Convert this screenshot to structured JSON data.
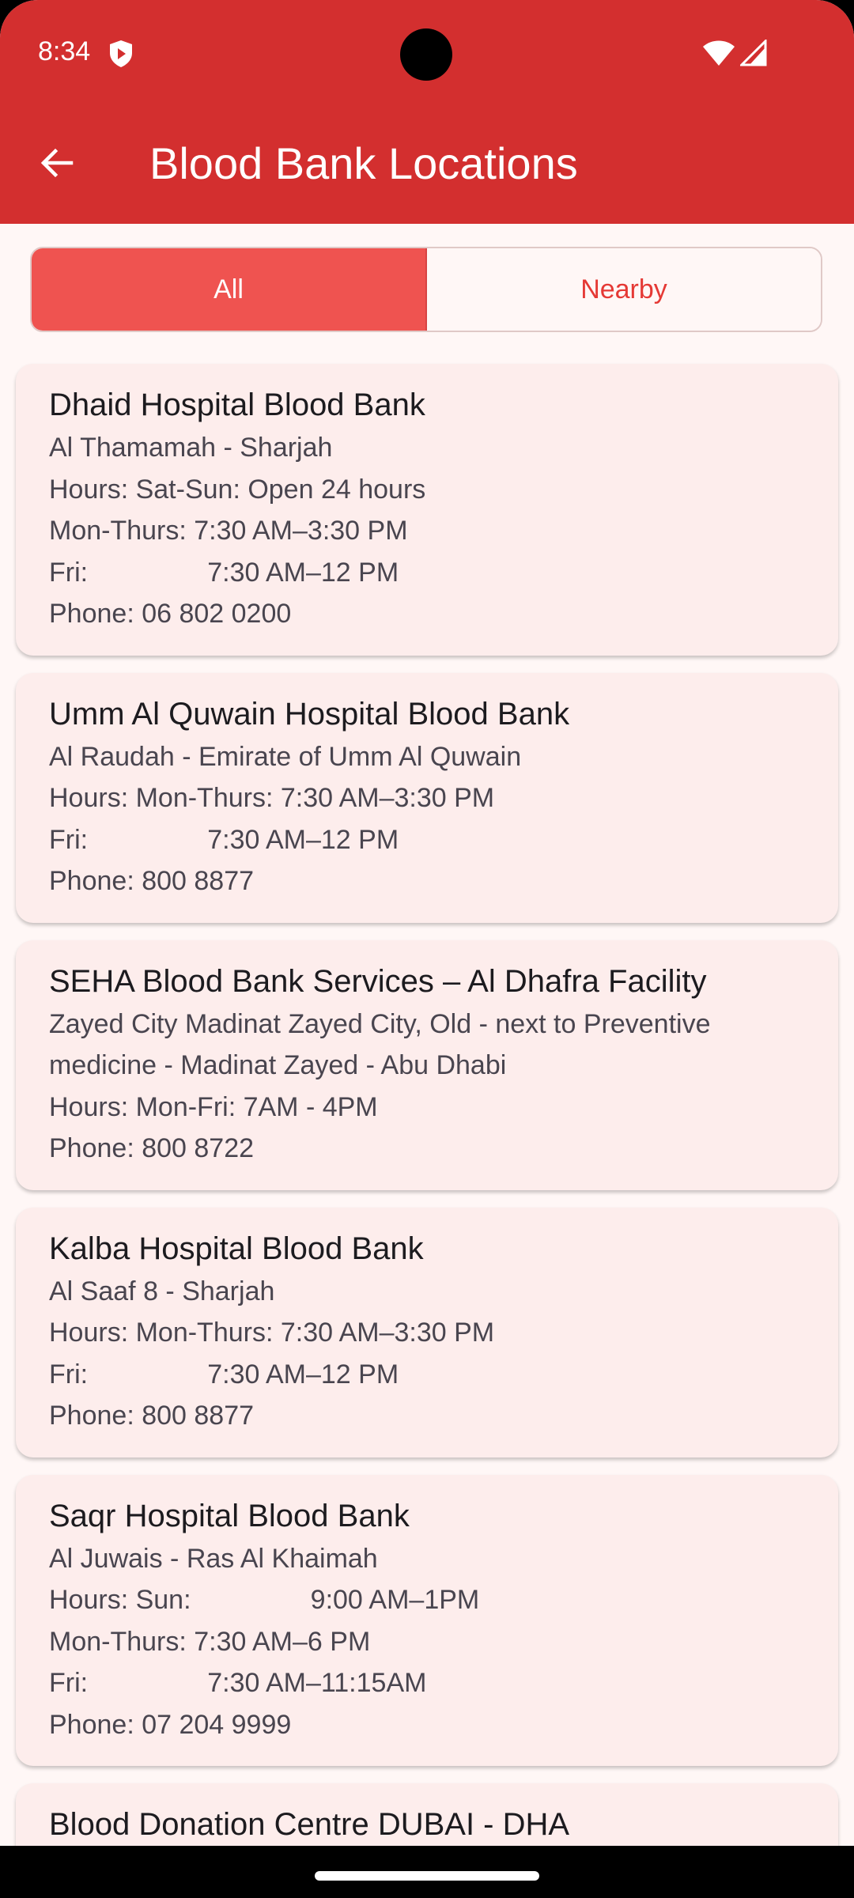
{
  "status_bar": {
    "time": "8:34"
  },
  "app_bar": {
    "title": "Blood Bank Locations"
  },
  "toggle": {
    "all_label": "All",
    "nearby_label": "Nearby"
  },
  "locations": [
    {
      "name": "Dhaid Hospital Blood Bank",
      "lines": [
        "Al Thamamah - Sharjah",
        "Hours: Sat-Sun: Open 24 hours",
        "Mon-Thurs: 7:30 AM–3:30 PM",
        "Fri:                7:30 AM–12 PM",
        "Phone: 06 802 0200"
      ]
    },
    {
      "name": "Umm Al Quwain Hospital Blood Bank",
      "lines": [
        "Al Raudah - Emirate of Umm Al Quwain",
        "Hours: Mon-Thurs: 7:30 AM–3:30 PM",
        "Fri:                7:30 AM–12 PM",
        "Phone: 800 8877"
      ]
    },
    {
      "name": "SEHA Blood Bank Services – Al Dhafra Facility",
      "lines": [
        "Zayed City Madinat Zayed City, Old - next to Preventive medicine - Madinat Zayed - Abu Dhabi",
        "Hours: Mon-Fri: 7AM - 4PM",
        "Phone: 800 8722"
      ]
    },
    {
      "name": "Kalba Hospital Blood Bank",
      "lines": [
        "Al Saaf 8 - Sharjah",
        "Hours: Mon-Thurs: 7:30 AM–3:30 PM",
        "Fri:                7:30 AM–12 PM",
        "Phone: 800 8877"
      ]
    },
    {
      "name": "Saqr Hospital Blood Bank",
      "lines": [
        "Al Juwais - Ras Al Khaimah",
        "Hours: Sun:                9:00 AM–1PM",
        "Mon-Thurs: 7:30 AM–6 PM",
        "Fri:                7:30 AM–11:15AM",
        "Phone: 07 204 9999"
      ]
    },
    {
      "name": "Blood Donation Centre DUBAI - DHA",
      "lines": []
    }
  ],
  "colors": {
    "primary": "#D32F2F",
    "selected_segment": "#EF5350",
    "card_bg": "#FDEDEC",
    "page_bg": "#FFF7F6"
  },
  "icons": [
    "shield-icon",
    "wifi-icon",
    "signal-icon",
    "back-arrow-icon"
  ]
}
